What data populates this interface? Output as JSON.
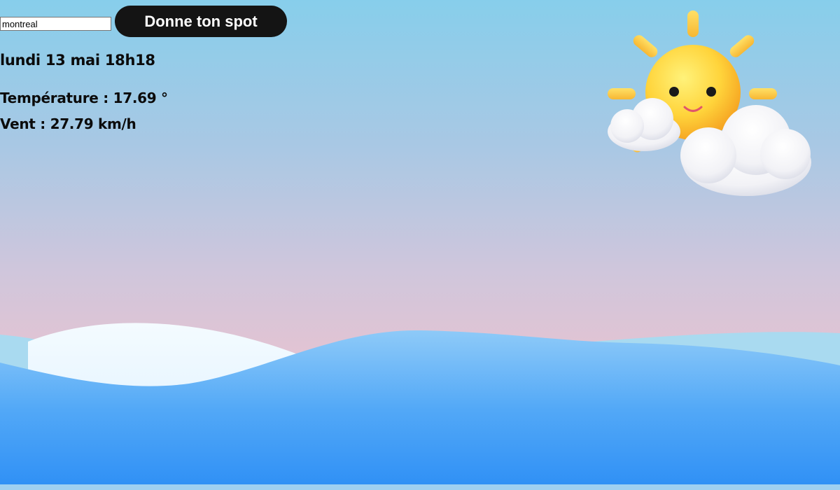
{
  "search": {
    "value": "montreal",
    "button_label": "Donne ton spot"
  },
  "weather": {
    "datetime": "lundi 13 mai 18h18",
    "temperature_text": "Température : 17.69 °",
    "wind_text": "Vent : 27.79 km/h",
    "icon": "sun-behind-clouds-icon"
  },
  "colors": {
    "sky_top": "#87ceeb",
    "sky_bottom": "#e2c4d3",
    "wave_front": "#3d9cf5",
    "wave_back": "#a9daf0",
    "wave_light": "#eef7ff",
    "button_bg": "#141414"
  }
}
